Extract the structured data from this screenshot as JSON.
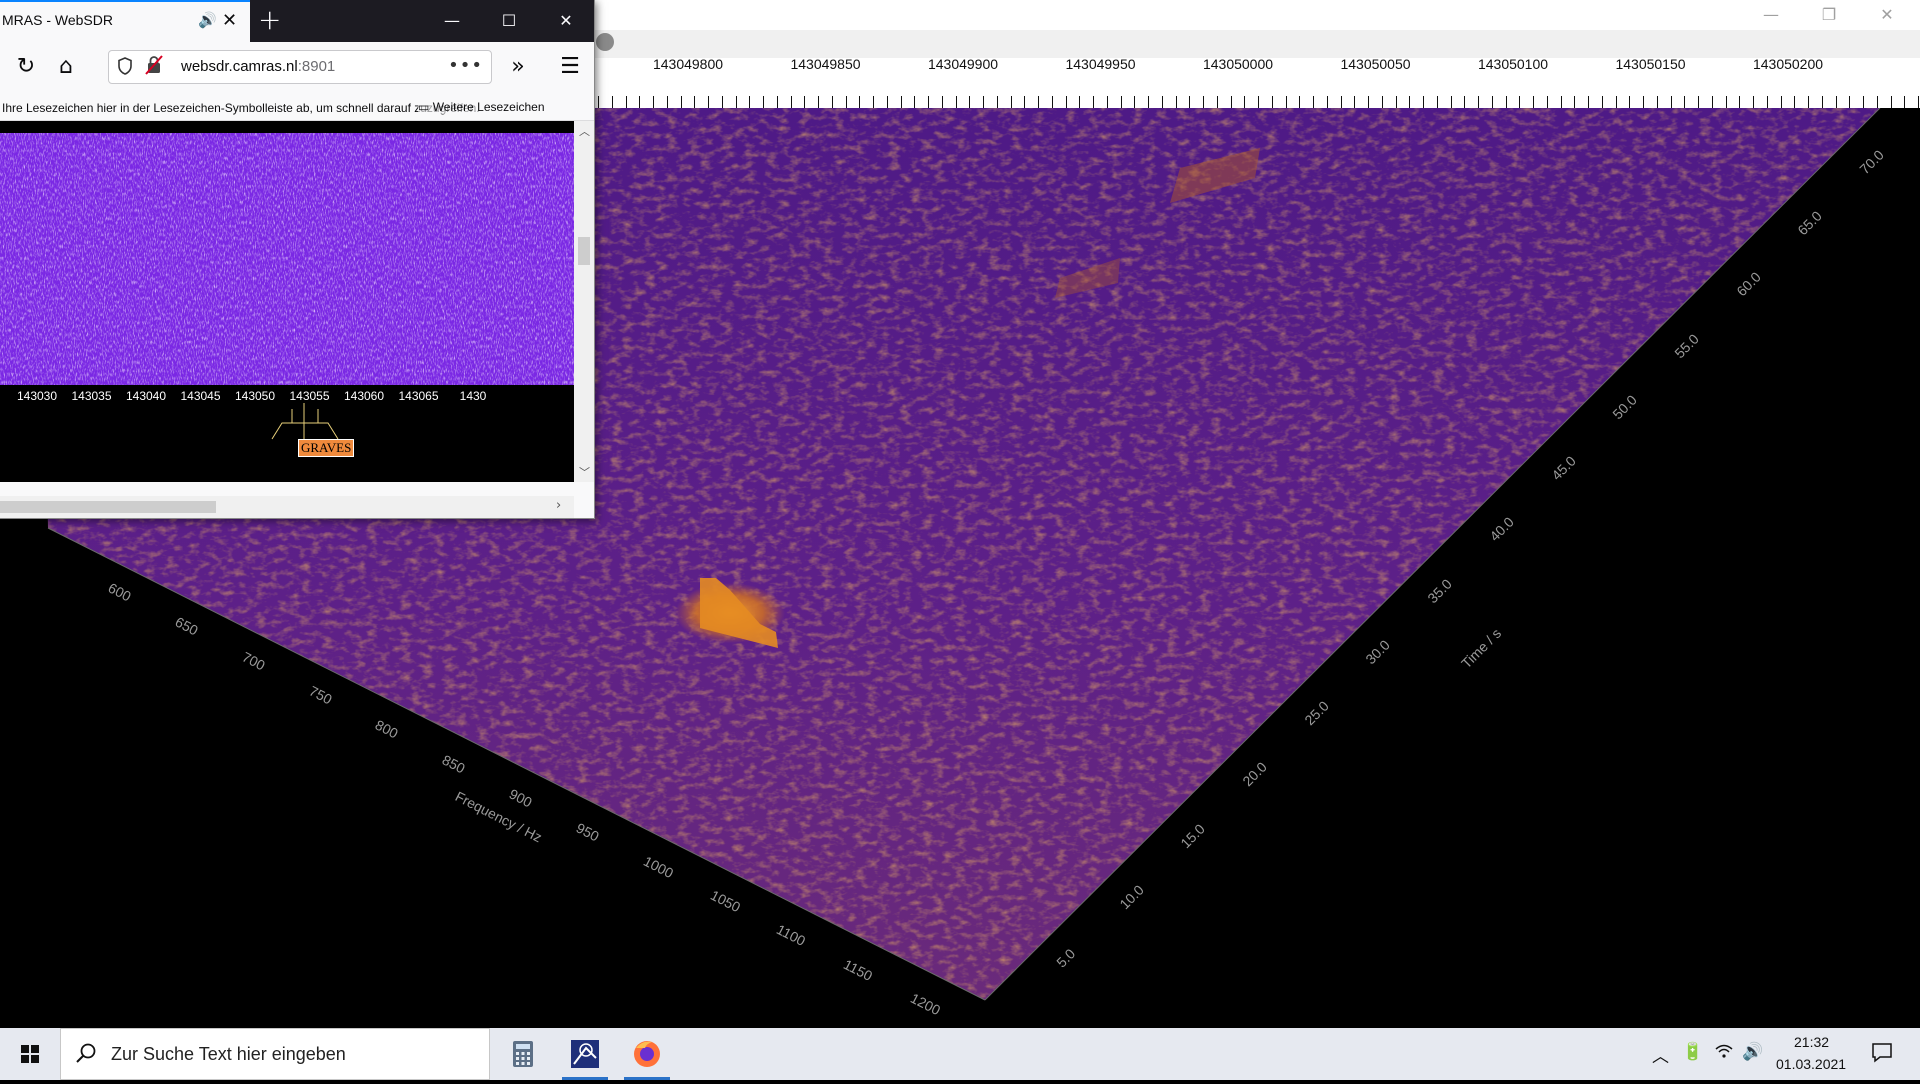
{
  "spectrum_app": {
    "window_controls": {
      "minimize": "—",
      "restore": "❐",
      "close": "✕"
    },
    "ruler_frequencies": [
      "143049800",
      "143049850",
      "143049900",
      "143049950",
      "143050000",
      "143050050",
      "143050100",
      "143050150",
      "143050200"
    ],
    "frequency_axis_title": "Frequency / Hz",
    "frequency_axis_ticks": [
      "600",
      "650",
      "700",
      "750",
      "800",
      "850",
      "900",
      "950",
      "1000",
      "1050",
      "1100",
      "1150",
      "1200"
    ],
    "time_axis_title": "Time / s",
    "time_axis_ticks": [
      "5.0",
      "10.0",
      "15.0",
      "20.0",
      "25.0",
      "30.0",
      "35.0",
      "40.0",
      "45.0",
      "50.0",
      "55.0",
      "60.0",
      "65.0",
      "70.0"
    ],
    "colors": {
      "plot_dark": "#3a1570",
      "plot_mid": "#5a1f8c",
      "plot_orange": "#d8781c",
      "highlight": "#f5a02a"
    }
  },
  "browser": {
    "tab_title": "MRAS - WebSDR",
    "tab_audio_icon": "🔊",
    "tab_close": "✕",
    "new_tab": "+",
    "window_controls": {
      "minimize": "—",
      "maximize": "☐",
      "close": "✕"
    },
    "nav": {
      "reload": "↻",
      "home": "⌂",
      "overflow": "»",
      "menu": "☰"
    },
    "url_domain": "websdr.camras.nl",
    "url_port": ":8901",
    "url_more": "•••",
    "bookmarks_hint": "Ihre Lesezeichen hier in der Lesezeichen-Symbolleiste ab, um schnell darauf zuzugreifen.",
    "bookmarks_more": "Weitere Lesezeichen",
    "sdr_frequencies": [
      "143030",
      "143035",
      "143040",
      "143045",
      "143050",
      "143055",
      "143060",
      "143065",
      "1430"
    ],
    "graves_label": "GRAVES",
    "waterfall_color": "#7a28e4"
  },
  "taskbar": {
    "search_placeholder": "Zur Suche Text hier eingeben",
    "time": "21:32",
    "date": "01.03.2021"
  }
}
